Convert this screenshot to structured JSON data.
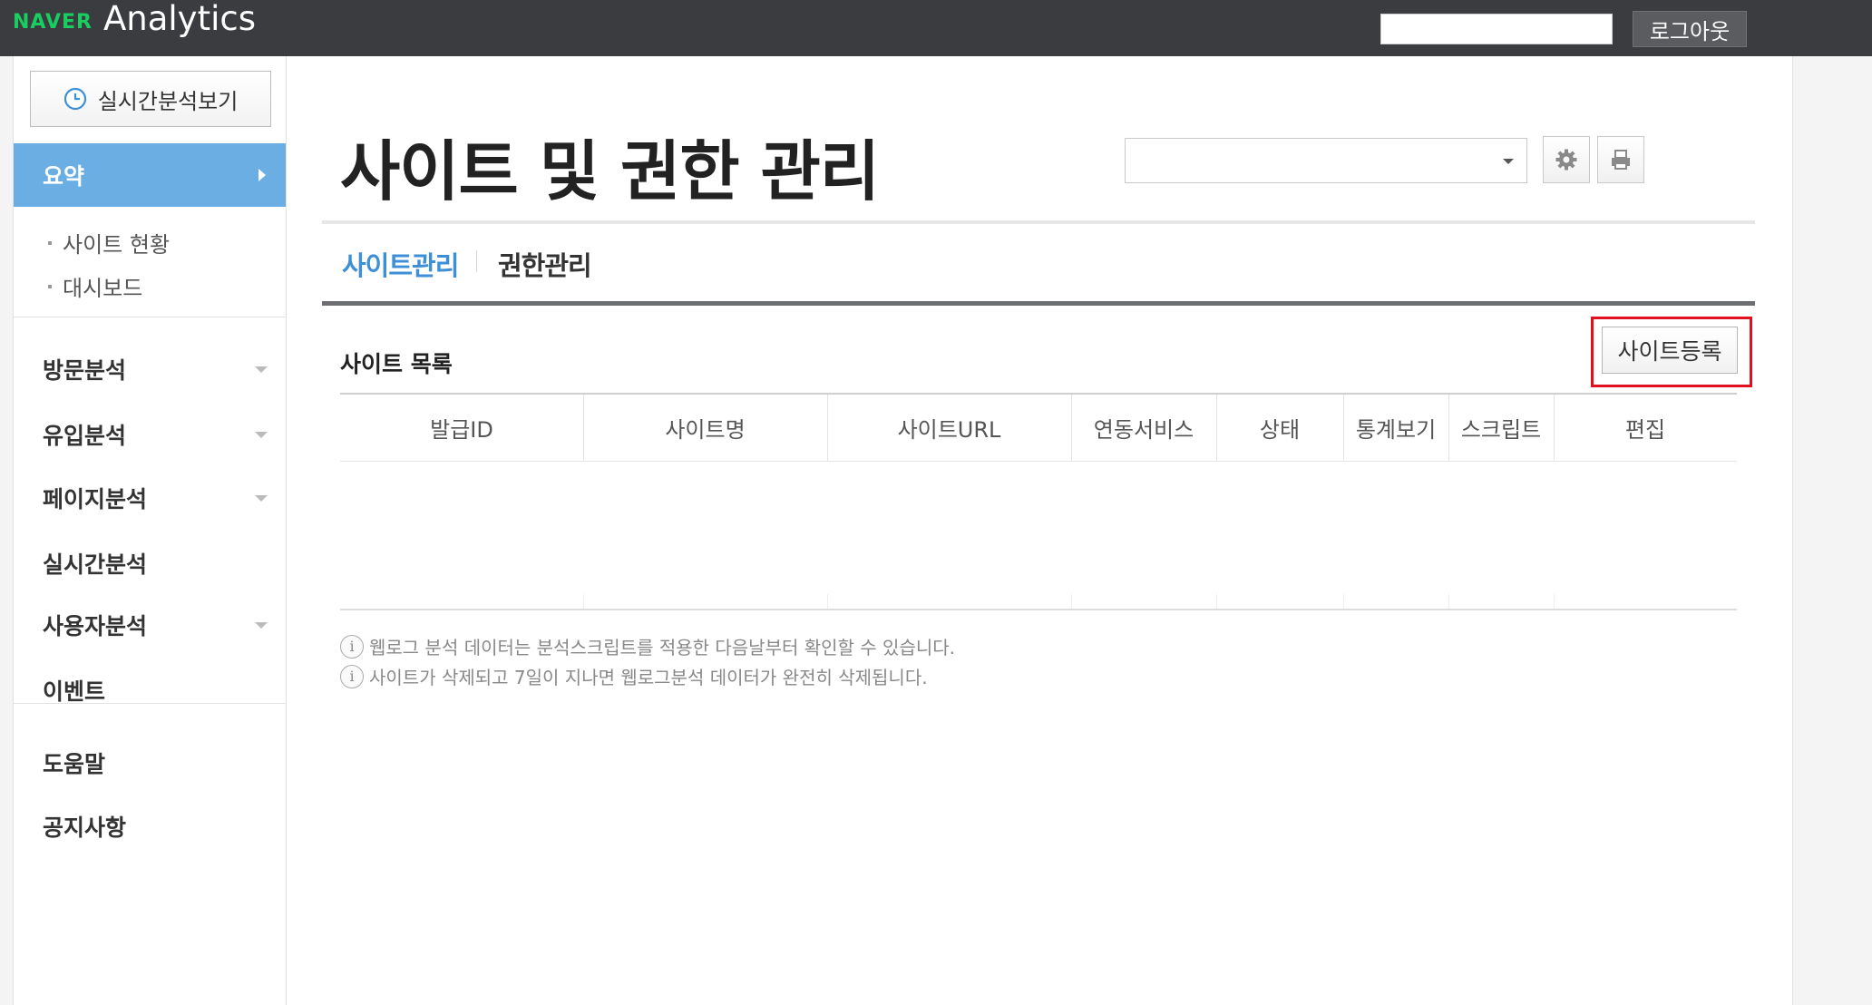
{
  "header": {
    "logo_brand": "NAVER",
    "logo_product": "Analytics",
    "logout_label": "로그아웃",
    "user_box_value": ""
  },
  "sidebar": {
    "realtime_button": "실시간분석보기",
    "summary": "요약",
    "summary_subitems": [
      "사이트 현황",
      "대시보드"
    ],
    "menu": [
      "방문분석",
      "유입분석",
      "페이지분석",
      "실시간분석",
      "사용자분석",
      "이벤트"
    ],
    "footer_menu": [
      "도움말",
      "공지사항"
    ]
  },
  "main": {
    "title": "사이트 및 권한 관리",
    "site_select_value": "",
    "tabs": [
      "사이트관리",
      "권한관리"
    ],
    "section_title": "사이트 목록",
    "register_button": "사이트등록",
    "table_headers": [
      "발급ID",
      "사이트명",
      "사이트URL",
      "연동서비스",
      "상태",
      "통계보기",
      "스크립트",
      "편집"
    ],
    "table_rows": [],
    "notes": [
      "웹로그 분석 데이터는 분석스크립트를 적용한 다음날부터 확인할 수 있습니다.",
      "사이트가 삭제되고 7일이 지나면 웹로그분석 데이터가 완전히 삭제됩니다."
    ],
    "info_icon_glyph": "i"
  },
  "colors": {
    "topbar": "#3a3c3f",
    "naver_green": "#19ce60",
    "summary_active": "#6aaee3",
    "active_tab": "#3d8fd6",
    "highlight_red": "#e0101e"
  }
}
